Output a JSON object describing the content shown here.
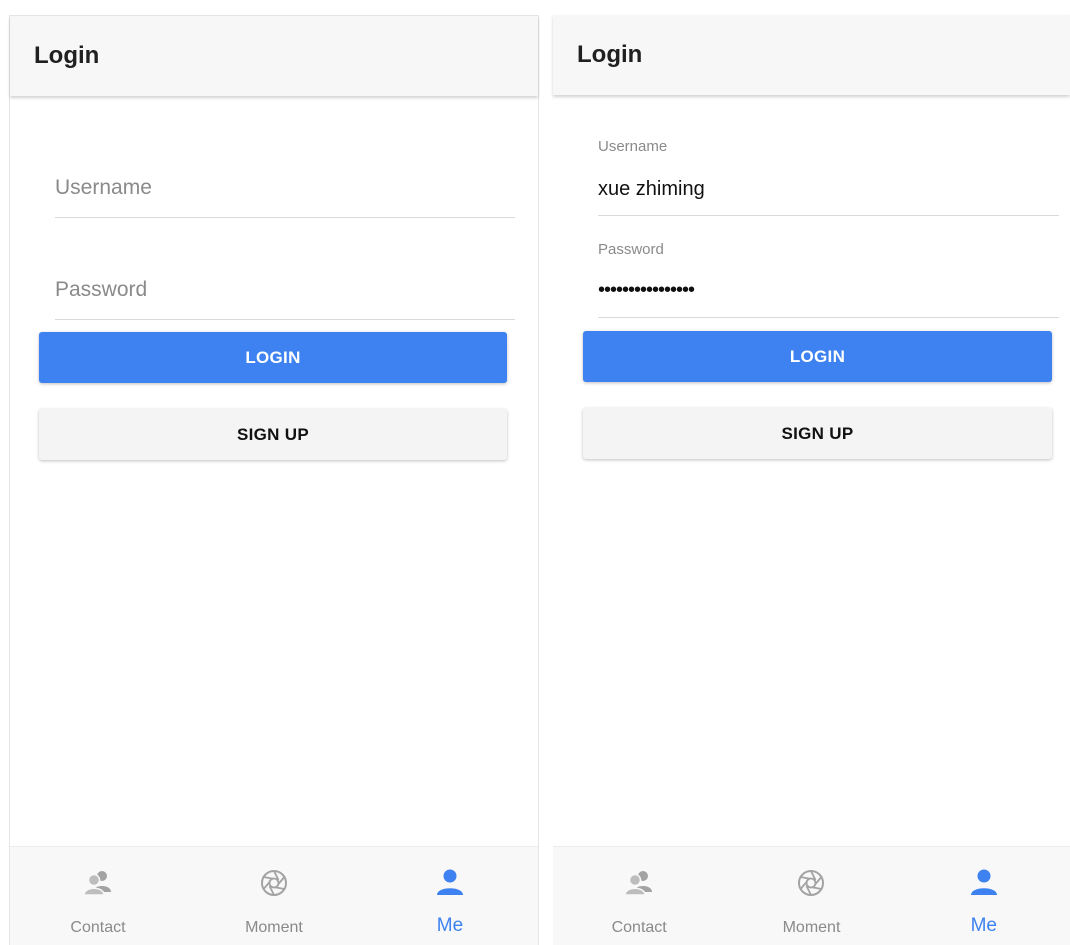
{
  "colors": {
    "accent": "#3d82f0",
    "inactive": "#9e9e9e"
  },
  "screens": [
    {
      "title": "Login",
      "username": {
        "placeholder": "Username",
        "value": ""
      },
      "password": {
        "placeholder": "Password",
        "value": ""
      },
      "login_label": "LOGIN",
      "signup_label": "SIGN UP"
    },
    {
      "title": "Login",
      "username": {
        "label": "Username",
        "value": "xue zhiming"
      },
      "password": {
        "label": "Password",
        "value": "••••••••••••••••"
      },
      "login_label": "LOGIN",
      "signup_label": "SIGN UP"
    }
  ],
  "tabs": [
    {
      "label": "Contact",
      "icon": "contacts-icon",
      "active": false
    },
    {
      "label": "Moment",
      "icon": "aperture-icon",
      "active": false
    },
    {
      "label": "Me",
      "icon": "person-icon",
      "active": true
    }
  ]
}
